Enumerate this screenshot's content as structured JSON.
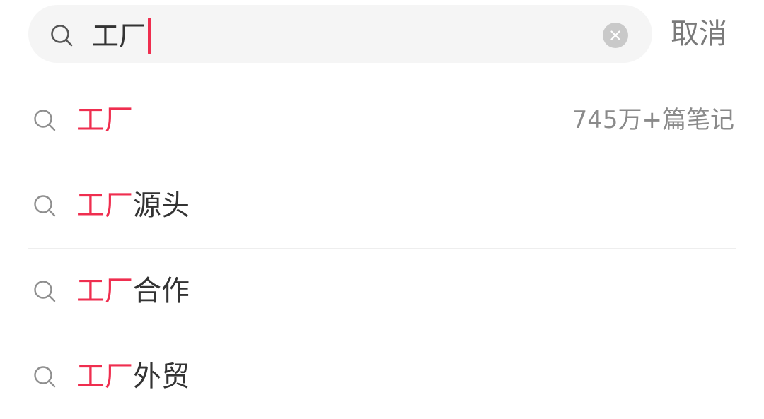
{
  "search": {
    "query": "工厂",
    "icon": "search-icon",
    "clear_icon": "close-icon",
    "cancel_label": "取消"
  },
  "colors": {
    "accent": "#ef2e4f",
    "text": "#333333",
    "muted": "#8a8a8a",
    "search_bg": "#f5f5f5"
  },
  "suggestions": [
    {
      "highlight": "工厂",
      "rest": "",
      "count": "745万+篇笔记"
    },
    {
      "highlight": "工厂",
      "rest": "源头",
      "count": ""
    },
    {
      "highlight": "工厂",
      "rest": "合作",
      "count": ""
    },
    {
      "highlight": "工厂",
      "rest": "外贸",
      "count": ""
    }
  ]
}
